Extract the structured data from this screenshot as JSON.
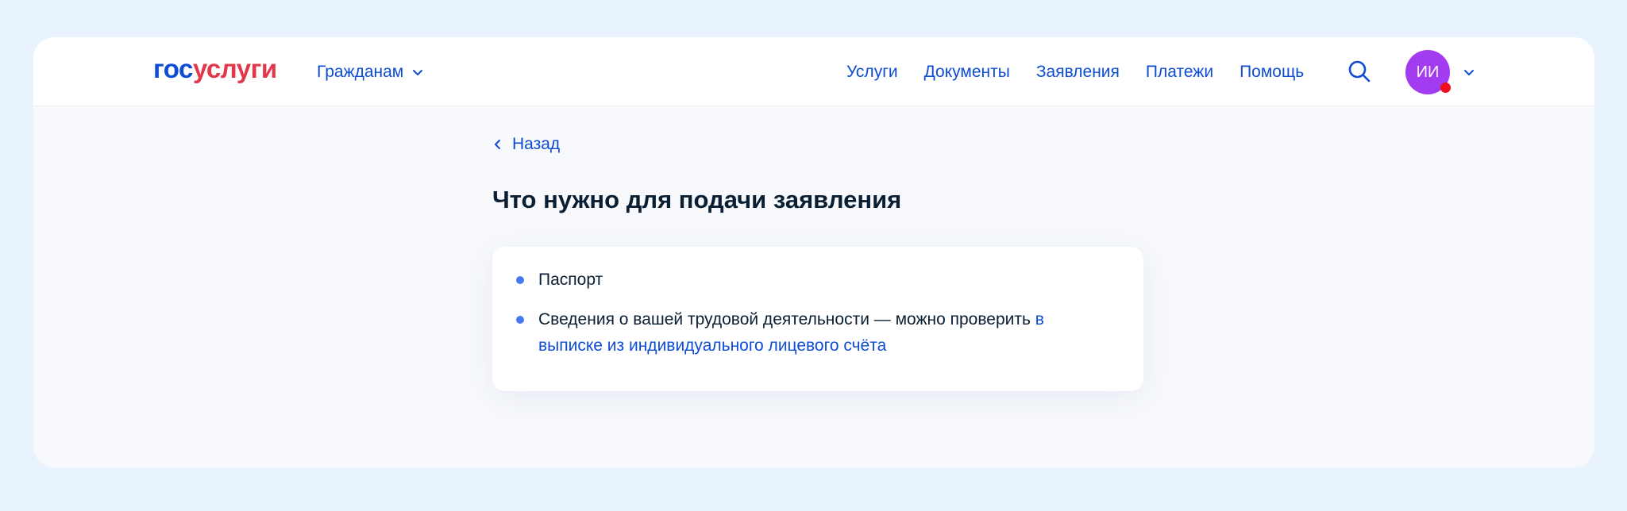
{
  "header": {
    "logo_part1": "гос",
    "logo_part2": "услуги",
    "audience_label": "Гражданам",
    "nav": [
      "Услуги",
      "Документы",
      "Заявления",
      "Платежи",
      "Помощь"
    ],
    "avatar_initials": "ИИ"
  },
  "main": {
    "back_label": "Назад",
    "title": "Что нужно для подачи заявления",
    "items": [
      {
        "text": "Паспорт"
      },
      {
        "text": "Сведения о вашей трудовой деятельности — можно проверить ",
        "link": "в выписке из индивидуального лицевого счёта"
      }
    ]
  },
  "colors": {
    "page_bg": "#e9f3fe",
    "brand_blue": "#0d4cd3",
    "brand_red": "#e3374a",
    "avatar": "#a33cf0",
    "notification": "#ee0f1f",
    "bullet": "#4678f0"
  }
}
